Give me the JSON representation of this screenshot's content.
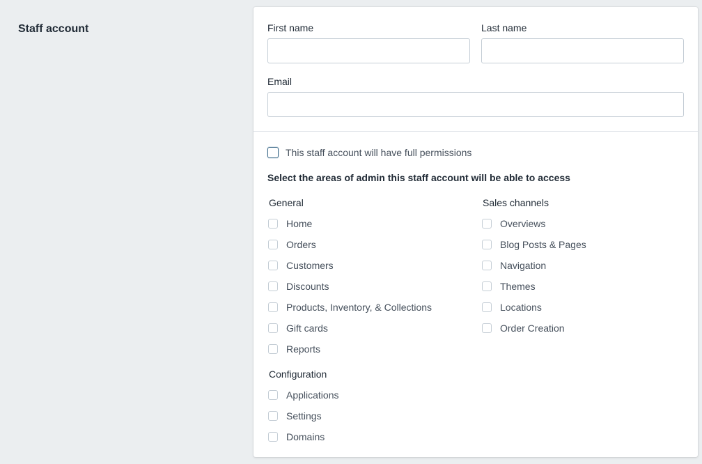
{
  "section": {
    "title": "Staff account"
  },
  "form": {
    "first_name": {
      "label": "First name",
      "value": "",
      "placeholder": ""
    },
    "last_name": {
      "label": "Last name",
      "value": "",
      "placeholder": ""
    },
    "email": {
      "label": "Email",
      "value": "",
      "placeholder": ""
    }
  },
  "permissions": {
    "full_permissions_label": "This staff account will have full permissions",
    "full_permissions_checked": false,
    "areas_heading": "Select the areas of admin this staff account will be able to access",
    "groups": [
      {
        "heading": "General",
        "items": [
          {
            "label": "Home",
            "checked": false
          },
          {
            "label": "Orders",
            "checked": false
          },
          {
            "label": "Customers",
            "checked": false
          },
          {
            "label": "Discounts",
            "checked": false
          },
          {
            "label": "Products, Inventory, & Collections",
            "checked": false
          },
          {
            "label": "Gift cards",
            "checked": false
          },
          {
            "label": "Reports",
            "checked": false
          }
        ]
      },
      {
        "heading": "Sales channels",
        "items": [
          {
            "label": "Overviews",
            "checked": false
          },
          {
            "label": "Blog Posts & Pages",
            "checked": false
          },
          {
            "label": "Navigation",
            "checked": false
          },
          {
            "label": "Themes",
            "checked": false
          },
          {
            "label": "Locations",
            "checked": false
          },
          {
            "label": "Order Creation",
            "checked": false
          }
        ]
      },
      {
        "heading": "Configuration",
        "items": [
          {
            "label": "Applications",
            "checked": false
          },
          {
            "label": "Settings",
            "checked": false
          },
          {
            "label": "Domains",
            "checked": false
          }
        ]
      }
    ]
  },
  "colors": {
    "page_background": "#ebeef0",
    "card_background": "#ffffff",
    "checkbox_border": "#c4cdd5",
    "focus_border": "#3f6c8b"
  }
}
